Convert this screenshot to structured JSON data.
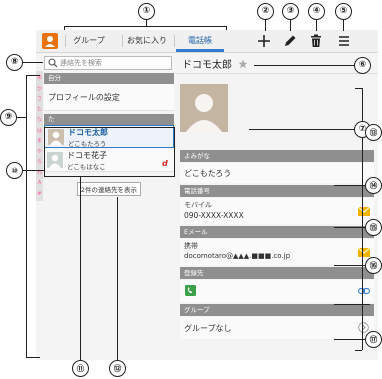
{
  "callouts": {
    "c1": "①",
    "c2": "②",
    "c3": "③",
    "c4": "④",
    "c5": "⑤",
    "c6": "⑥",
    "c7": "⑦",
    "c8": "⑧",
    "c9": "⑨",
    "c10": "⑩",
    "c11": "⑪",
    "c12": "⑫",
    "c13": "⑬",
    "c14": "⑭",
    "c15": "⑮",
    "c16": "⑯",
    "c17": "⑰"
  },
  "tabs": [
    "グループ",
    "お気に入り",
    "電話帳"
  ],
  "selected_tab": 2,
  "toolbar_icons": [
    "add-icon",
    "edit-pencil-icon",
    "trash-icon",
    "menu-icon"
  ],
  "search": {
    "placeholder": "連絡先を検索"
  },
  "index_letters": [
    "あ",
    "か",
    "さ",
    "た",
    "な",
    "は",
    "ま",
    "や",
    "ら",
    "わ",
    "A",
    "#"
  ],
  "sections": {
    "self": "自分",
    "ta": "た"
  },
  "profile_setting": "プロフィールの設定",
  "contacts": [
    {
      "name": "ドコモ太郎",
      "reading": "どこもたろう",
      "selected": true
    },
    {
      "name": "ドコモ花子",
      "reading": "どこもはなこ",
      "badge": "d"
    }
  ],
  "show_count": "2件の連絡先を表示",
  "detail": {
    "name": "ドコモ太郎",
    "yomigana_label": "よみがな",
    "yomigana_value": "どこもたろう",
    "phone_label": "電話番号",
    "phone_type": "モバイル",
    "phone_number": "090-XXXX-XXXX",
    "email_label": "Eメール",
    "email_type": "携帯",
    "email_address": "docomotaro@▲▲▲.■■■.co.jp",
    "registered_label": "登録先",
    "group_label": "グループ",
    "group_value": "グループなし"
  },
  "colors": {
    "accent": "#2e7bd1",
    "selected_name": "#1a5fa8",
    "section_header": "#8f8f8f",
    "mail_icon": "#f0b400",
    "phone_icon": "#3aa04a",
    "app_icon": "#e8720c",
    "badge": "#d9261c"
  }
}
